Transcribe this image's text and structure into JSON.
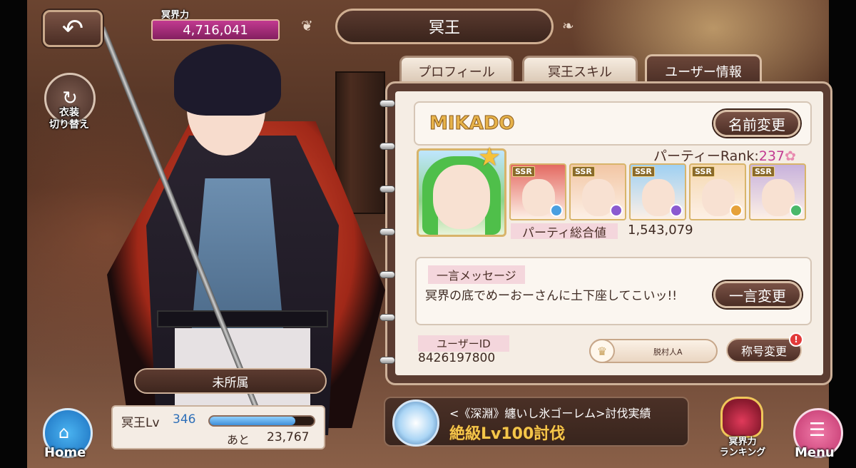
{
  "header": {
    "back_icon": "back-arrow-icon",
    "power_label": "冥界力",
    "power_value": "4,716,041",
    "title": "冥王"
  },
  "costume": {
    "icon": "swap-cycle-icon",
    "label_line1": "衣装",
    "label_line2": "切り替え"
  },
  "tabs": [
    {
      "label": "プロフィール",
      "active": false
    },
    {
      "label": "冥王スキル",
      "active": false
    },
    {
      "label": "ユーザー情報",
      "active": true
    }
  ],
  "user": {
    "name": "MIKADO",
    "rename_button": "名前変更",
    "party_rank_label": "パーティーRank:",
    "party_rank_value": "237",
    "party_total_label": "パーティ総合値",
    "party_total_value": "1,543,079",
    "members": [
      {
        "rarity": "SSR",
        "color": "#e46a62",
        "orb": "#4a9fe0"
      },
      {
        "rarity": "SSR",
        "color": "#f2c6a4",
        "orb": "#8a5ad0"
      },
      {
        "rarity": "SSR",
        "color": "#9fd0f2",
        "orb": "#8a5ad0"
      },
      {
        "rarity": "SSR",
        "color": "#f5d8b0",
        "orb": "#e6a23a"
      },
      {
        "rarity": "SSR",
        "color": "#c8b2dc",
        "orb": "#4ab86a"
      }
    ],
    "message_label": "一言メッセージ",
    "message_text": "冥界の底でめーおーさんに土下座してこいッ!!",
    "message_button": "一言変更",
    "user_id_label": "ユーザーID",
    "user_id_value": "8426197800",
    "title_value": "脱村人A",
    "title_button": "称号変更",
    "title_badge": "!"
  },
  "affiliation": "未所属",
  "level": {
    "label": "冥王Lv",
    "value": "346",
    "progress": 0.82,
    "next_label": "あと",
    "next_value": "23,767"
  },
  "raid": {
    "line1": "<《深淵》纏いし氷ゴーレム>討伐実績",
    "line2": "絶級Lv100討伐"
  },
  "nav": {
    "home_label": "Home",
    "ranking_line1": "冥界力",
    "ranking_line2": "ランキング",
    "menu_label": "Menu"
  }
}
